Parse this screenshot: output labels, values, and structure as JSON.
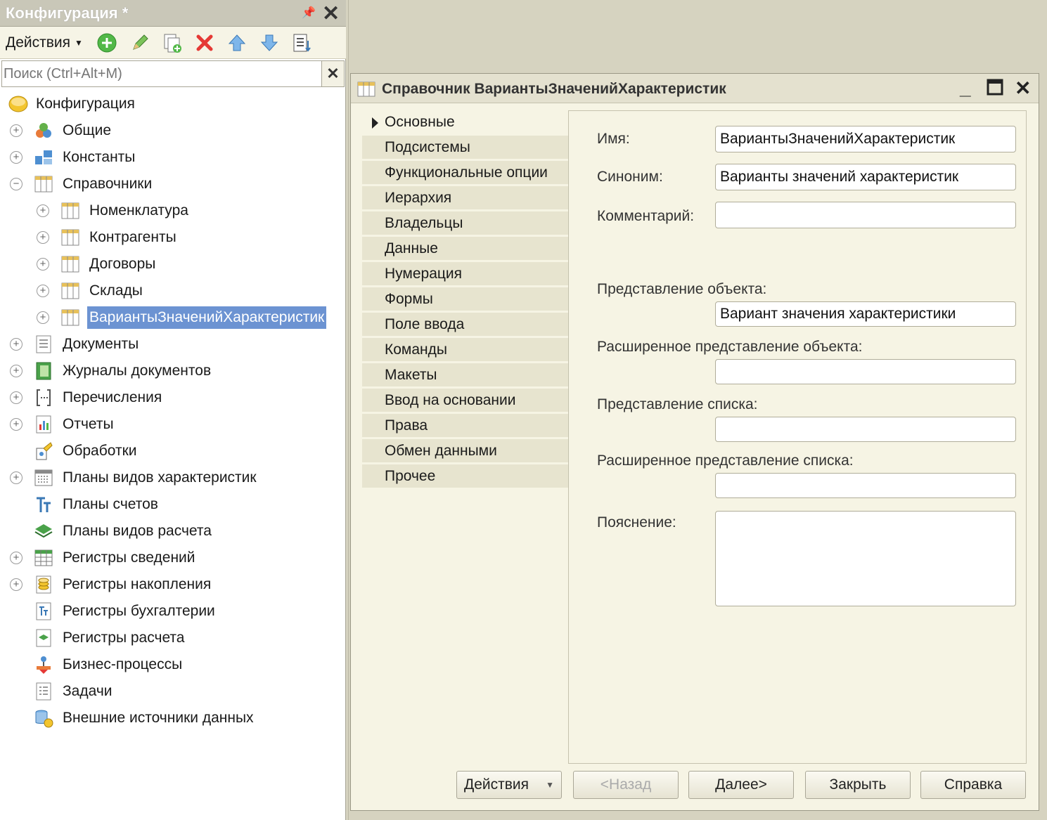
{
  "left_panel": {
    "title": "Конфигурация *",
    "toolbar": {
      "actions_label": "Действия"
    },
    "search": {
      "placeholder": "Поиск (Ctrl+Alt+M)"
    },
    "tree": {
      "root": "Конфигурация",
      "items": [
        "Общие",
        "Константы",
        "Справочники",
        "Номенклатура",
        "Контрагенты",
        "Договоры",
        "Склады",
        "ВариантыЗначенийХарактеристик",
        "Документы",
        "Журналы документов",
        "Перечисления",
        "Отчеты",
        "Обработки",
        "Планы видов характеристик",
        "Планы счетов",
        "Планы видов расчета",
        "Регистры сведений",
        "Регистры накопления",
        "Регистры бухгалтерии",
        "Регистры расчета",
        "Бизнес-процессы",
        "Задачи",
        "Внешние источники данных"
      ]
    }
  },
  "window": {
    "title": "Справочник ВариантыЗначенийХарактеристик",
    "tabs": [
      "Основные",
      "Подсистемы",
      "Функциональные опции",
      "Иерархия",
      "Владельцы",
      "Данные",
      "Нумерация",
      "Формы",
      "Поле ввода",
      "Команды",
      "Макеты",
      "Ввод на основании",
      "Права",
      "Обмен данными",
      "Прочее"
    ],
    "form": {
      "name_label": "Имя:",
      "name_value": "ВариантыЗначенийХарактеристик",
      "synonym_label": "Синоним:",
      "synonym_value": "Варианты значений характеристик",
      "comment_label": "Комментарий:",
      "comment_value": "",
      "object_repr_label": "Представление объекта:",
      "object_repr_value": "Вариант значения характеристики",
      "ext_object_repr_label": "Расширенное представление объекта:",
      "list_repr_label": "Представление списка:",
      "ext_list_repr_label": "Расширенное представление списка:",
      "explanation_label": "Пояснение:"
    },
    "buttons": {
      "actions": "Действия",
      "back": "<Назад",
      "next": "Далее>",
      "close": "Закрыть",
      "help": "Справка"
    }
  }
}
